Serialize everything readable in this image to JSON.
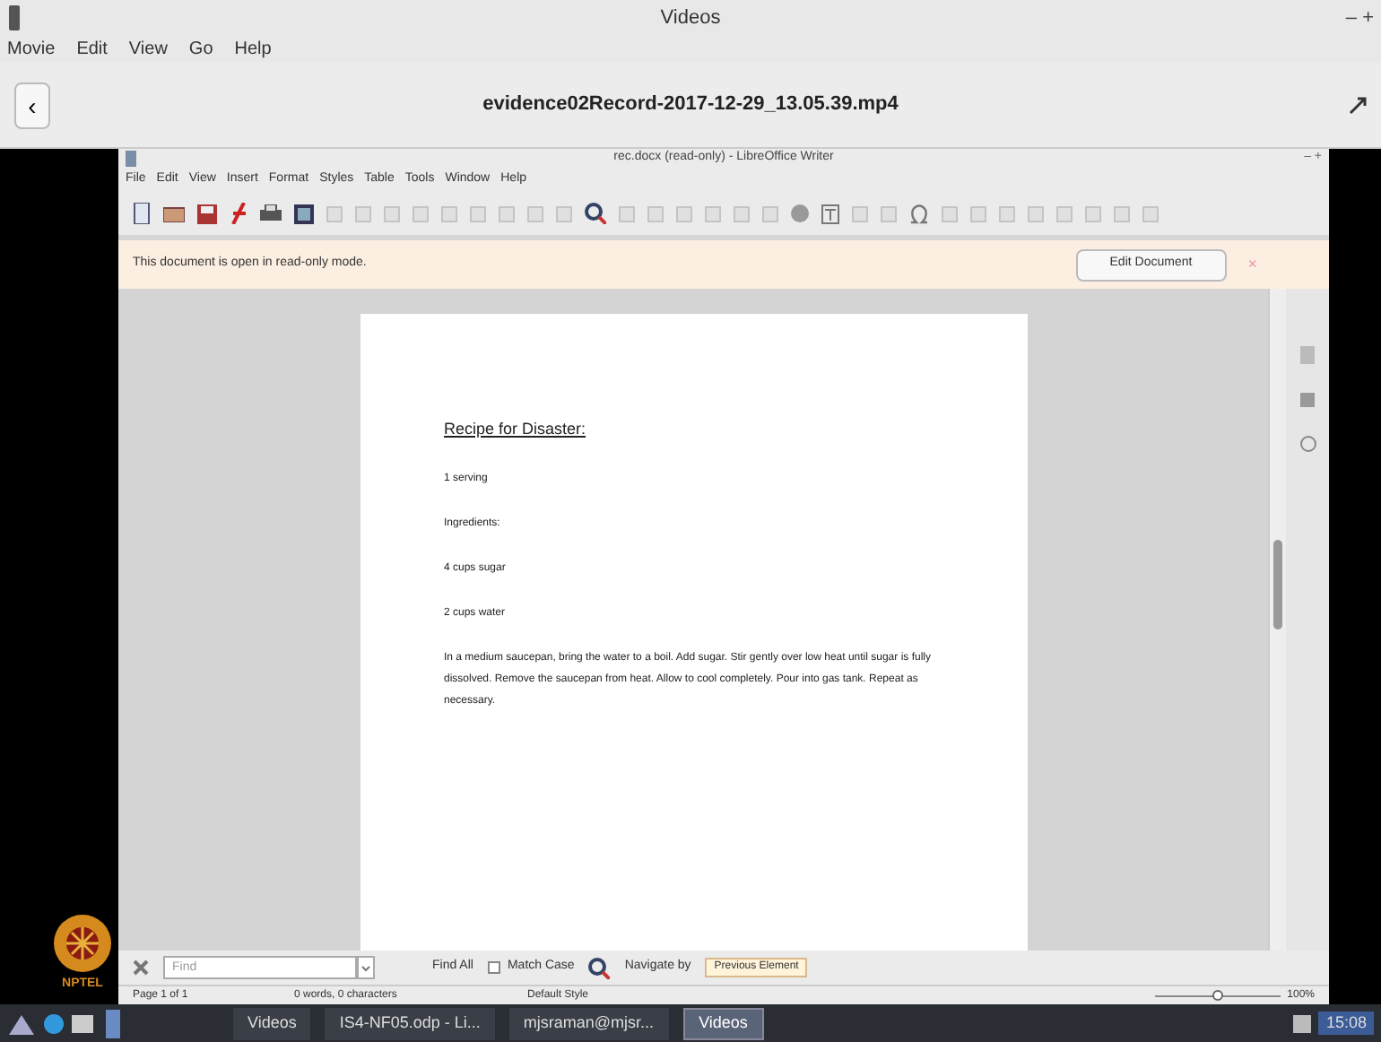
{
  "player": {
    "title": "Videos",
    "window_controls": "– +",
    "menu": [
      "Movie",
      "Edit",
      "View",
      "Go",
      "Help"
    ],
    "back": "‹",
    "file_title": "evidence02Record-2017-12-29_13.05.39.mp4"
  },
  "writer": {
    "title": "rec.docx (read-only) - LibreOffice Writer",
    "window_controls": "– +",
    "menu": [
      "File",
      "Edit",
      "View",
      "Insert",
      "Format",
      "Styles",
      "Table",
      "Tools",
      "Window",
      "Help"
    ],
    "infobar": {
      "message": "This document is open in read-only mode.",
      "button": "Edit Document",
      "close": "×"
    },
    "document": {
      "heading": "Recipe for Disaster:",
      "paragraphs": [
        "1 serving",
        "Ingredients:",
        "4 cups sugar",
        "2 cups water",
        "In a medium saucepan, bring the water to a boil. Add sugar. Stir gently over low heat until sugar is fully dissolved. Remove the saucepan from heat. Allow to cool completely. Pour into gas tank. Repeat as necessary."
      ]
    },
    "find_bar": {
      "placeholder": "Find",
      "find_all": "Find All",
      "match_case": {
        "label": "Match Case",
        "checked": false
      },
      "navigate_by": "Navigate by",
      "tooltip": "Previous Element"
    },
    "status_bar": {
      "page": "Page 1 of 1",
      "words": "0 words, 0 characters",
      "style": "Default Style",
      "zoom": "100%",
      "zoom_slider": {
        "level": 0.5
      }
    }
  },
  "logo": "NPTEL",
  "taskbar": {
    "items": [
      {
        "label": "Videos",
        "selected": false
      },
      {
        "label": "IS4-NF05.odp - Li...",
        "selected": false
      },
      {
        "label": "mjsraman@mjsr...",
        "selected": false
      },
      {
        "label": "Videos",
        "selected": true
      }
    ],
    "clock": "15:08"
  }
}
